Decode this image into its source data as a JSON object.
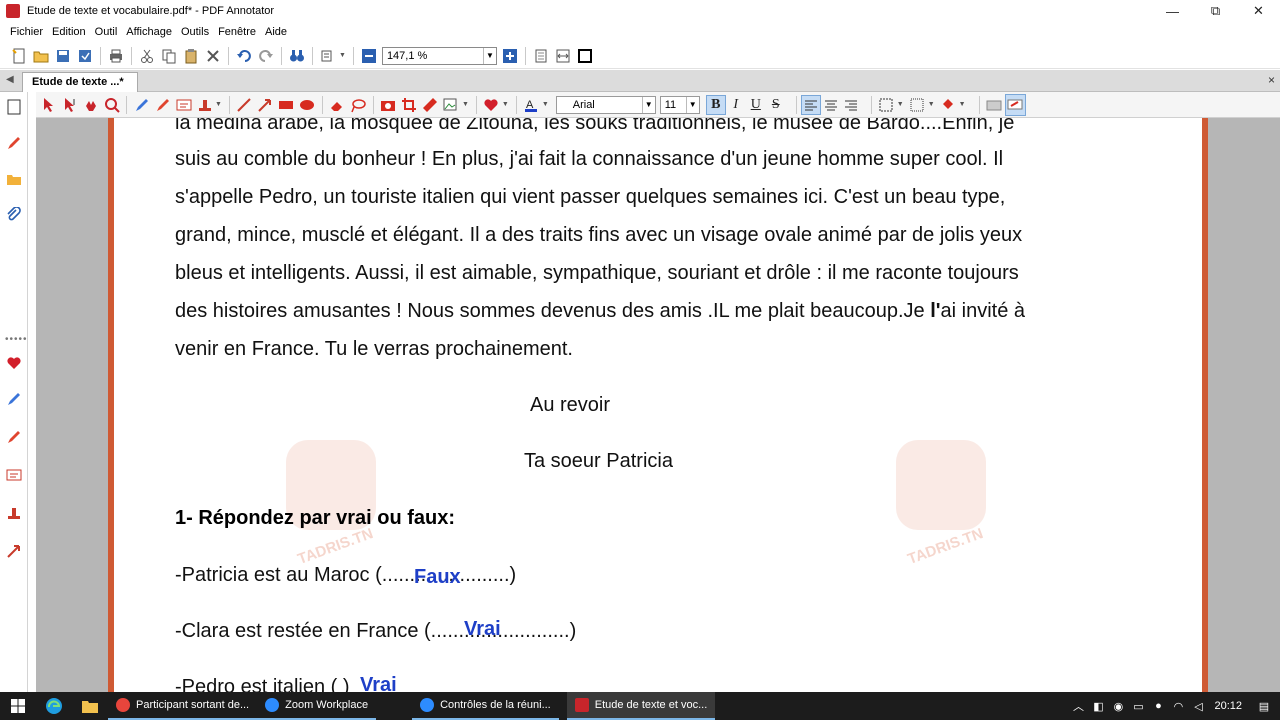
{
  "window": {
    "title": "Etude de texte et vocabulaire.pdf* - PDF Annotator",
    "minimize": "—",
    "restore": "⧉",
    "close": "✕"
  },
  "menu": [
    "Fichier",
    "Edition",
    "Outil",
    "Affichage",
    "Outils",
    "Fenêtre",
    "Aide"
  ],
  "toolbar": {
    "zoom_value": "147,1 %"
  },
  "tabs": {
    "active_label": "Etude de texte ...*",
    "close": "×"
  },
  "annotate": {
    "font_name": "Arial",
    "font_size": "11",
    "bold": "B",
    "italic": "I",
    "underline": "U",
    "strike": "S"
  },
  "document": {
    "lines": [
      "la médina arabe, la mosquée de Zitouna, les souks traditionnels, le musée de Bardo....Enfin, je",
      "suis au comble du bonheur ! En plus, j'ai fait la connaissance d'un jeune homme super cool. Il",
      "s'appelle Pedro, un touriste italien qui vient passer quelques semaines ici. C'est un beau type,",
      "grand, mince, musclé et élégant. Il a des traits fins avec un visage ovale animé par de jolis yeux",
      "bleus et intelligents. Aussi, il est aimable, sympathique, souriant et drôle : il me raconte toujours",
      "venir en France. Tu le verras prochainement."
    ],
    "line6_part1": "des histoires amusantes ! Nous sommes devenus des amis .IL me plait beaucoup.Je ",
    "line6_bold": "l'",
    "line6_part2": "ai invité à",
    "closing": "Au revoir",
    "signature": "Ta soeur Patricia",
    "question_heading": "1- Répondez par vrai ou faux:",
    "questions": [
      {
        "text": "-Patricia est au Maroc (.......................)",
        "answer": "Faux"
      },
      {
        "text": "-Clara est restée en France (.........................)",
        "answer": "Vrai"
      },
      {
        "text": "-Pedro est italien (                        )",
        "answer": "Vrai"
      }
    ],
    "watermark_text": "TADRIS.TN"
  },
  "taskbar": {
    "apps": [
      {
        "label": "Participant sortant de...",
        "color": "#e8453c"
      },
      {
        "label": "Zoom Workplace",
        "color": "#2d8cff"
      },
      {
        "label": "Contrôles de la réuni...",
        "color": "#2d8cff"
      },
      {
        "label": "Etude de texte et voc...",
        "color": "#c8252b"
      }
    ],
    "time": "20:12"
  }
}
